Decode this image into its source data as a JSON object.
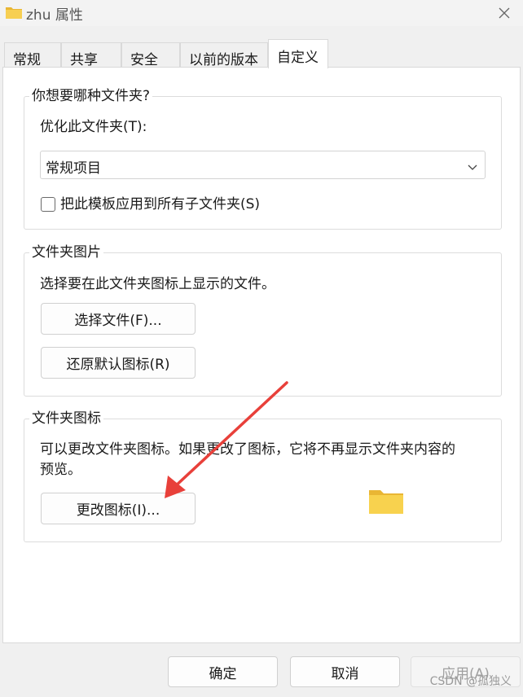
{
  "window": {
    "title": "zhu 属性",
    "folder_icon": "folder-icon",
    "close_icon": "close-icon"
  },
  "tabs": [
    {
      "label": "常规"
    },
    {
      "label": "共享"
    },
    {
      "label": "安全"
    },
    {
      "label": "以前的版本"
    },
    {
      "label": "自定义",
      "active": true
    }
  ],
  "group_optimize": {
    "title": "你想要哪种文件夹?",
    "label": "优化此文件夹(T):",
    "select_value": "常规项目",
    "checkbox_label": "把此模板应用到所有子文件夹(S)",
    "checkbox_checked": false
  },
  "group_picture": {
    "title": "文件夹图片",
    "description": "选择要在此文件夹图标上显示的文件。",
    "choose_button": "选择文件(F)...",
    "restore_button": "还原默认图标(R)"
  },
  "group_icon": {
    "title": "文件夹图标",
    "description_line1": "可以更改文件夹图标。如果更改了图标，它将不再显示文件夹内容的",
    "description_line2": "预览。",
    "change_button": "更改图标(I)..."
  },
  "footer": {
    "ok": "确定",
    "cancel": "取消",
    "apply": "应用(A)"
  },
  "watermark": "CSDN @孤独义",
  "colors": {
    "arrow": "#e8403a",
    "folder": "#f5c842"
  }
}
